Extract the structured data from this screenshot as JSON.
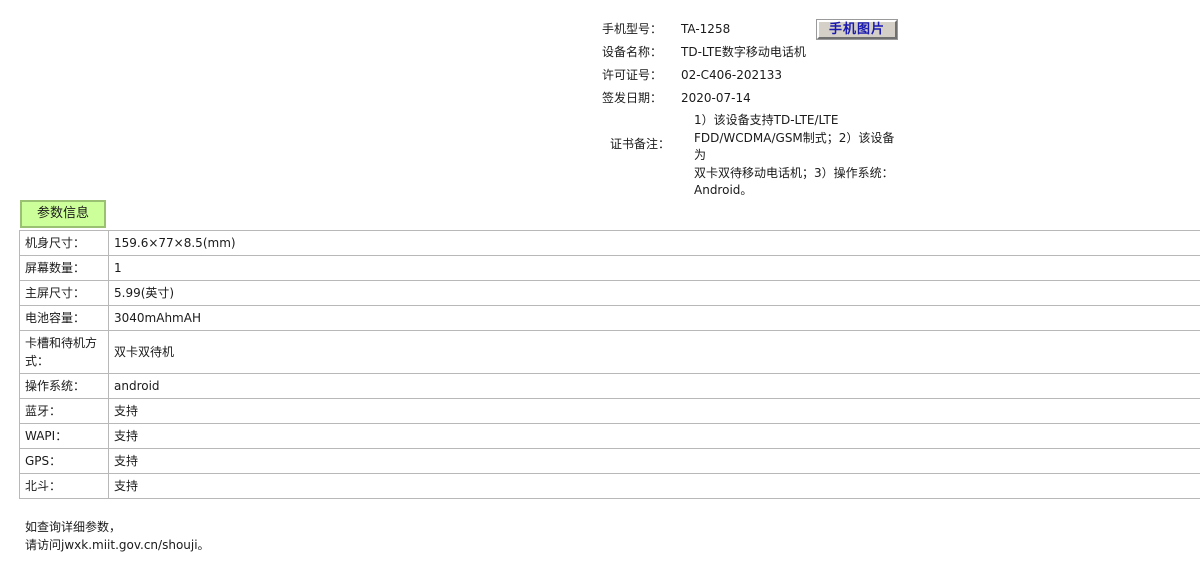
{
  "info": {
    "model_label": "手机型号：",
    "model_value": "TA-1258",
    "photo_button": "手机图片",
    "device_label": "设备名称：",
    "device_value": "TD-LTE数字移动电话机",
    "license_label": "许可证号：",
    "license_value": "02-C406-202133",
    "date_label": "签发日期：",
    "date_value": "2020-07-14",
    "remark_label": "证书备注：",
    "remark_lines": [
      "1）该设备支持TD-LTE/LTE",
      "FDD/WCDMA/GSM制式；2）该设备为",
      "双卡双待移动电话机；3）操作系统：",
      "Android。"
    ]
  },
  "params": {
    "header": "参数信息",
    "rows": [
      {
        "label": "机身尺寸：",
        "value": "159.6×77×8.5(mm)"
      },
      {
        "label": "屏幕数量：",
        "value": "1"
      },
      {
        "label": "主屏尺寸：",
        "value": "5.99(英寸)"
      },
      {
        "label": "电池容量：",
        "value": "3040mAhmAH"
      },
      {
        "label": "卡槽和待机方式：",
        "value": "双卡双待机"
      },
      {
        "label": "操作系统：",
        "value": "android"
      },
      {
        "label": "蓝牙：",
        "value": "支持"
      },
      {
        "label": "WAPI：",
        "value": "支持"
      },
      {
        "label": "GPS：",
        "value": "支持"
      },
      {
        "label": "北斗：",
        "value": "支持"
      }
    ]
  },
  "footer": {
    "line1": "如查询详细参数，",
    "line2": "请访问jwxk.miit.gov.cn/shouji。"
  }
}
